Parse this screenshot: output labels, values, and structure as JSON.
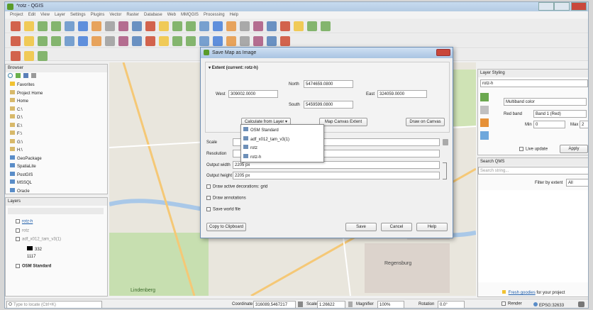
{
  "window": {
    "title": "*rotz - QGIS",
    "accent": "#b4cbe3"
  },
  "menubar": {
    "items": [
      "Project",
      "Edit",
      "View",
      "Layer",
      "Settings",
      "Plugins",
      "Vector",
      "Raster",
      "Database",
      "Web",
      "MMQGIS",
      "Processing",
      "Help"
    ]
  },
  "browser": {
    "title": "Browser",
    "items": [
      "Favorites",
      "Project Home",
      "Home",
      "C:\\",
      "D:\\",
      "E:\\",
      "F:\\",
      "G:\\",
      "H:\\",
      "GeoPackage",
      "SpatiaLite",
      "PostGIS",
      "MSSQL",
      "Oracle"
    ]
  },
  "layers": {
    "title": "Layers",
    "items": [
      {
        "label": "rotz-h",
        "style": "link"
      },
      {
        "label": "rotz",
        "style": "gray"
      },
      {
        "label": "adf_x012_tam_v3(1)",
        "style": "gray"
      },
      {
        "label": "332",
        "style": "normal"
      },
      {
        "label": "1117",
        "style": "normal"
      },
      {
        "label": "OSM Standard",
        "style": "bold"
      }
    ]
  },
  "layer_styling": {
    "title": "Layer Styling",
    "layer_select": "rotz-h",
    "renderer": "Multiband color",
    "red_band_label": "Red band",
    "red_band_value": "Band 1 (Red)",
    "min_label": "Min",
    "min_value": "0",
    "max_label": "Max",
    "max_value": "2",
    "live_update_label": "Live update",
    "apply_label": "Apply"
  },
  "search_qms": {
    "title": "Search QMS",
    "placeholder": "Search string...",
    "filter_label": "Filter by extent",
    "filter_value": "All"
  },
  "news": {
    "link": "Fresh goodies",
    "text": "for your project"
  },
  "dialog": {
    "title": "Save Map as Image",
    "extent_title": "Extent (current: rotz-h)",
    "north_label": "North",
    "north_value": "5474659.0800",
    "west_label": "West",
    "west_value": "309002.0000",
    "east_label": "East",
    "east_value": "324059.0000",
    "south_label": "South",
    "south_value": "5459599.0800",
    "calc_from_layer": "Calculate from Layer",
    "map_canvas_extent": "Map Canvas Extent",
    "draw_on_canvas": "Draw on Canvas",
    "scale_label": "Scale",
    "resolution_label": "Resolution",
    "output_width_label": "Output width",
    "output_width_value": "2205 px",
    "output_height_label": "Output height",
    "output_height_value": "2205 px",
    "draw_decorations": "Draw active decorations: grid",
    "draw_annotations": "Draw annotations",
    "save_worldfile": "Save world file",
    "copy_clipboard": "Copy to Clipboard",
    "save": "Save",
    "cancel": "Cancel",
    "help": "Help"
  },
  "layer_popup": {
    "items": [
      "OSM Standard",
      "adf_x012_tam_v3(1)",
      "rotz",
      "rotz-h"
    ]
  },
  "map_labels": {
    "place1": "Regensburg",
    "place2": "Lindenberg"
  },
  "status": {
    "locator_placeholder": "Type to locate (Ctrl+K)",
    "coordinate_label": "Coordinate",
    "coordinate_value": "316089,5467217",
    "scale_label": "Scale",
    "scale_value": "1:26622",
    "magnifier_label": "Magnifier",
    "magnifier_value": "100%",
    "rotation_label": "Rotation",
    "rotation_value": "0.0°",
    "render_label": "Render",
    "crs": "EPSG:32633"
  }
}
